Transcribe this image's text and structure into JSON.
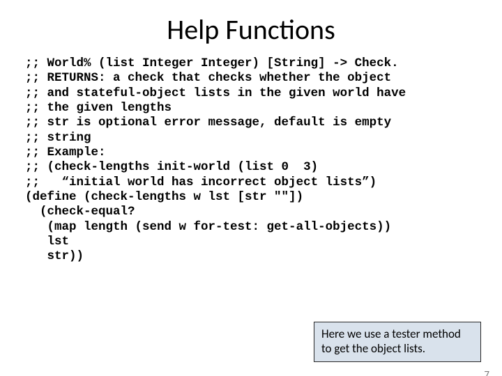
{
  "title": "Help Functions",
  "code": ";; World% (list Integer Integer) [String] -> Check.\n;; RETURNS: a check that checks whether the object\n;; and stateful-object lists in the given world have\n;; the given lengths\n;; str is optional error message, default is empty\n;; string\n;; Example:\n;; (check-lengths init-world (list 0  3)\n;;   “initial world has incorrect object lists”)\n(define (check-lengths w lst [str \"\"])\n  (check-equal?\n   (map length (send w for-test: get-all-objects))\n   lst\n   str))",
  "callout": "Here we use a tester method to get the object lists.",
  "page_number": "7"
}
